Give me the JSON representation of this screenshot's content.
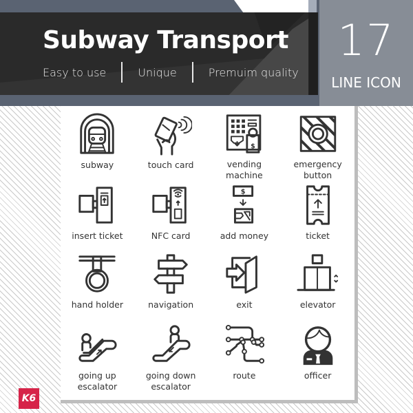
{
  "header": {
    "title": "Subway Transport",
    "taglines": [
      "Easy to use",
      "Unique",
      "Premuim quality"
    ],
    "icon_count": "17",
    "icon_style": "LINE ICON"
  },
  "colors": {
    "header_band": "#5a6372",
    "title_panel": "#2a2a2a",
    "count_box": "#878d96",
    "icon_stroke": "#333333",
    "logo_accent": "#d62449"
  },
  "icons": [
    {
      "label": "subway",
      "icon": "subway-tunnel-icon"
    },
    {
      "label": "touch card",
      "icon": "touch-card-icon"
    },
    {
      "label": "vending machine",
      "icon": "vending-machine-icon"
    },
    {
      "label": "emergency\nbutton",
      "icon": "emergency-button-icon"
    },
    {
      "label": "insert ticket",
      "icon": "insert-ticket-icon"
    },
    {
      "label": "NFC card",
      "icon": "nfc-card-icon"
    },
    {
      "label": "add money",
      "icon": "add-money-icon"
    },
    {
      "label": "ticket",
      "icon": "ticket-icon"
    },
    {
      "label": "hand holder",
      "icon": "hand-holder-icon"
    },
    {
      "label": "navigation",
      "icon": "signpost-icon"
    },
    {
      "label": "exit",
      "icon": "exit-door-icon"
    },
    {
      "label": "elevator",
      "icon": "elevator-icon"
    },
    {
      "label": "going up\nescalator",
      "icon": "escalator-up-icon"
    },
    {
      "label": "going down\nescalator",
      "icon": "escalator-down-icon"
    },
    {
      "label": "route",
      "icon": "route-map-icon"
    },
    {
      "label": "officer",
      "icon": "officer-icon"
    }
  ],
  "logo": {
    "text": "K6"
  }
}
